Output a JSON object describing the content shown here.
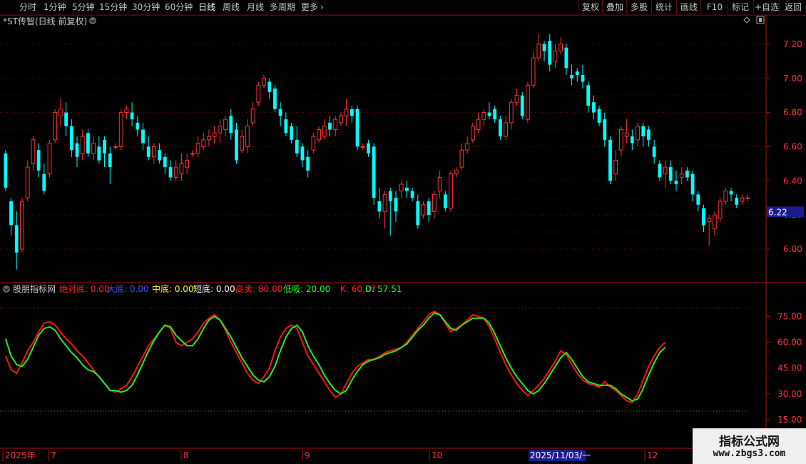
{
  "toolbar": {
    "periods": [
      "分时",
      "1分钟",
      "5分钟",
      "15分钟",
      "30分钟",
      "60分钟",
      "日线",
      "周线",
      "月线",
      "多周期",
      "更多"
    ],
    "active_period": "日线",
    "right": [
      "复权",
      "叠加",
      "多股",
      "统计",
      "画线",
      "F10",
      "标记",
      "+自选",
      "返回"
    ]
  },
  "price_panel": {
    "title": "*ST传智(日线 前复权)",
    "y_labels": [
      "7.20",
      "7.00",
      "6.80",
      "6.60",
      "6.40",
      "6.20",
      "6.00"
    ],
    "last_price": "6.22"
  },
  "indicator_panel": {
    "title": "股朋指标网",
    "items": [
      {
        "label": "绝对底:",
        "value": "0.00",
        "color": "#ff2222"
      },
      {
        "label": "大底:",
        "value": "0.00",
        "color": "#3355ff"
      },
      {
        "label": "中底:",
        "value": "0.00",
        "color": "#ffff00"
      },
      {
        "label": "短底:",
        "value": "0.00",
        "color": "#ffffff"
      },
      {
        "label": "高卖:",
        "value": "80.00",
        "color": "#ff2222"
      },
      {
        "label": "低吸:",
        "value": "20.00",
        "color": "#22ff22"
      },
      {
        "label": "K:",
        "value": "60.07",
        "color": "#ff2222"
      },
      {
        "label": "D:",
        "value": "57.51",
        "color": "#22ff22"
      }
    ],
    "y_labels": [
      "75.00",
      "60.00",
      "45.00",
      "30.00",
      "15.00"
    ]
  },
  "date_axis": {
    "labels": [
      "2025年",
      "7",
      "8",
      "9",
      "10",
      "11",
      "12"
    ],
    "cursor_date": "2025/11/03/一"
  },
  "watermark": {
    "title": "指标公式网",
    "url": "www.zbgs3.com"
  },
  "colors": {
    "up": "#ff3333",
    "down": "#00ffff",
    "k": "#ff1111",
    "d": "#22ee22",
    "grid": "#8b0000"
  },
  "chart_data": {
    "type": "candlestick",
    "title": "*ST传智(日线 前复权)",
    "ylim": [
      5.82,
      7.3
    ],
    "candles": [
      [
        6.56,
        6.36,
        6.58,
        6.34
      ],
      [
        6.28,
        6.14,
        6.3,
        6.08
      ],
      [
        6.14,
        5.98,
        6.22,
        5.88
      ],
      [
        6.0,
        6.28,
        6.3,
        5.98
      ],
      [
        6.3,
        6.48,
        6.52,
        6.28
      ],
      [
        6.5,
        6.64,
        6.66,
        6.46
      ],
      [
        6.58,
        6.46,
        6.62,
        6.42
      ],
      [
        6.44,
        6.34,
        6.5,
        6.32
      ],
      [
        6.44,
        6.62,
        6.64,
        6.42
      ],
      [
        6.64,
        6.8,
        6.82,
        6.62
      ],
      [
        6.78,
        6.82,
        6.88,
        6.72
      ],
      [
        6.8,
        6.72,
        6.86,
        6.66
      ],
      [
        6.72,
        6.58,
        6.76,
        6.54
      ],
      [
        6.62,
        6.54,
        6.66,
        6.48
      ],
      [
        6.56,
        6.66,
        6.7,
        6.52
      ],
      [
        6.68,
        6.56,
        6.7,
        6.54
      ],
      [
        6.56,
        6.62,
        6.66,
        6.52
      ],
      [
        6.6,
        6.52,
        6.66,
        6.5
      ],
      [
        6.64,
        6.56,
        6.66,
        6.48
      ],
      [
        6.56,
        6.48,
        6.6,
        6.38
      ],
      [
        6.6,
        6.6,
        6.62,
        6.58
      ],
      [
        6.6,
        6.8,
        6.82,
        6.58
      ],
      [
        6.8,
        6.82,
        6.84,
        6.76
      ],
      [
        6.8,
        6.76,
        6.86,
        6.72
      ],
      [
        6.74,
        6.7,
        6.78,
        6.66
      ],
      [
        6.7,
        6.62,
        6.74,
        6.58
      ],
      [
        6.6,
        6.54,
        6.66,
        6.52
      ],
      [
        6.54,
        6.6,
        6.62,
        6.5
      ],
      [
        6.58,
        6.52,
        6.62,
        6.5
      ],
      [
        6.54,
        6.48,
        6.56,
        6.44
      ],
      [
        6.48,
        6.42,
        6.52,
        6.4
      ],
      [
        6.42,
        6.48,
        6.52,
        6.4
      ],
      [
        6.44,
        6.5,
        6.56,
        6.4
      ],
      [
        6.48,
        6.52,
        6.56,
        6.44
      ],
      [
        6.56,
        6.56,
        6.58,
        6.54
      ],
      [
        6.56,
        6.62,
        6.66,
        6.54
      ],
      [
        6.6,
        6.64,
        6.68,
        6.58
      ],
      [
        6.64,
        6.66,
        6.7,
        6.6
      ],
      [
        6.66,
        6.68,
        6.72,
        6.62
      ],
      [
        6.68,
        6.72,
        6.76,
        6.62
      ],
      [
        6.7,
        6.76,
        6.78,
        6.66
      ],
      [
        6.78,
        6.68,
        6.82,
        6.64
      ],
      [
        6.7,
        6.52,
        6.74,
        6.5
      ],
      [
        6.58,
        6.66,
        6.7,
        6.56
      ],
      [
        6.6,
        6.72,
        6.76,
        6.56
      ],
      [
        6.74,
        6.82,
        6.86,
        6.72
      ],
      [
        6.86,
        6.96,
        6.98,
        6.84
      ],
      [
        6.96,
        7.0,
        7.02,
        6.94
      ],
      [
        6.98,
        6.92,
        7.0,
        6.88
      ],
      [
        6.94,
        6.82,
        6.96,
        6.8
      ],
      [
        6.82,
        6.78,
        6.86,
        6.72
      ],
      [
        6.76,
        6.68,
        6.8,
        6.66
      ],
      [
        6.72,
        6.64,
        6.74,
        6.62
      ],
      [
        6.64,
        6.56,
        6.72,
        6.54
      ],
      [
        6.6,
        6.52,
        6.62,
        6.48
      ],
      [
        6.54,
        6.46,
        6.58,
        6.42
      ],
      [
        6.58,
        6.66,
        6.68,
        6.56
      ],
      [
        6.64,
        6.7,
        6.72,
        6.62
      ],
      [
        6.66,
        6.72,
        6.76,
        6.64
      ],
      [
        6.74,
        6.7,
        6.78,
        6.66
      ],
      [
        6.7,
        6.76,
        6.78,
        6.66
      ],
      [
        6.74,
        6.78,
        6.8,
        6.72
      ],
      [
        6.78,
        6.82,
        6.88,
        6.72
      ],
      [
        6.82,
        6.78,
        6.84,
        6.74
      ],
      [
        6.82,
        6.6,
        6.84,
        6.58
      ],
      [
        6.6,
        6.6,
        6.62,
        6.58
      ],
      [
        6.62,
        6.56,
        6.64,
        6.54
      ],
      [
        6.6,
        6.3,
        6.62,
        6.26
      ],
      [
        6.28,
        6.22,
        6.36,
        6.18
      ],
      [
        6.22,
        6.32,
        6.34,
        6.12
      ],
      [
        6.34,
        6.28,
        6.36,
        6.08
      ],
      [
        6.3,
        6.22,
        6.34,
        6.16
      ],
      [
        6.34,
        6.38,
        6.4,
        6.3
      ],
      [
        6.36,
        6.34,
        6.4,
        6.3
      ],
      [
        6.34,
        6.3,
        6.36,
        6.28
      ],
      [
        6.28,
        6.14,
        6.32,
        6.12
      ],
      [
        6.2,
        6.26,
        6.28,
        6.18
      ],
      [
        6.28,
        6.2,
        6.3,
        6.16
      ],
      [
        6.22,
        6.32,
        6.34,
        6.18
      ],
      [
        6.34,
        6.42,
        6.46,
        6.3
      ],
      [
        6.32,
        6.24,
        6.34,
        6.22
      ],
      [
        6.24,
        6.44,
        6.46,
        6.22
      ],
      [
        6.44,
        6.46,
        6.48,
        6.42
      ],
      [
        6.48,
        6.58,
        6.62,
        6.46
      ],
      [
        6.58,
        6.62,
        6.66,
        6.56
      ],
      [
        6.64,
        6.72,
        6.74,
        6.62
      ],
      [
        6.7,
        6.76,
        6.8,
        6.68
      ],
      [
        6.76,
        6.8,
        6.82,
        6.72
      ],
      [
        6.8,
        6.78,
        6.86,
        6.76
      ],
      [
        6.82,
        6.76,
        6.84,
        6.74
      ],
      [
        6.76,
        6.66,
        6.78,
        6.64
      ],
      [
        6.66,
        6.74,
        6.78,
        6.64
      ],
      [
        6.74,
        6.86,
        6.88,
        6.7
      ],
      [
        6.86,
        6.9,
        6.94,
        6.84
      ],
      [
        6.9,
        6.78,
        6.92,
        6.76
      ],
      [
        6.76,
        6.96,
        6.98,
        6.74
      ],
      [
        6.96,
        7.12,
        7.16,
        6.94
      ],
      [
        7.12,
        7.2,
        7.26,
        7.1
      ],
      [
        7.2,
        7.16,
        7.22,
        7.1
      ],
      [
        7.22,
        7.08,
        7.26,
        7.04
      ],
      [
        7.1,
        7.16,
        7.2,
        7.06
      ],
      [
        7.16,
        7.2,
        7.24,
        7.14
      ],
      [
        7.18,
        7.06,
        7.2,
        7.02
      ],
      [
        7.02,
        7.0,
        7.08,
        6.96
      ],
      [
        7.04,
        7.02,
        7.06,
        6.98
      ],
      [
        7.02,
        6.98,
        7.08,
        6.94
      ],
      [
        6.96,
        6.84,
        6.98,
        6.8
      ],
      [
        6.86,
        6.8,
        6.9,
        6.76
      ],
      [
        6.82,
        6.74,
        6.84,
        6.72
      ],
      [
        6.76,
        6.64,
        6.8,
        6.6
      ],
      [
        6.64,
        6.4,
        6.66,
        6.38
      ],
      [
        6.44,
        6.52,
        6.58,
        6.4
      ],
      [
        6.58,
        6.7,
        6.72,
        6.54
      ],
      [
        6.66,
        6.68,
        6.76,
        6.62
      ],
      [
        6.66,
        6.62,
        6.7,
        6.58
      ],
      [
        6.64,
        6.72,
        6.74,
        6.6
      ],
      [
        6.72,
        6.66,
        6.74,
        6.6
      ],
      [
        6.7,
        6.64,
        6.72,
        6.6
      ],
      [
        6.6,
        6.54,
        6.64,
        6.5
      ],
      [
        6.5,
        6.42,
        6.52,
        6.4
      ],
      [
        6.44,
        6.48,
        6.52,
        6.36
      ],
      [
        6.48,
        6.4,
        6.52,
        6.38
      ],
      [
        6.4,
        6.38,
        6.46,
        6.34
      ],
      [
        6.42,
        6.44,
        6.48,
        6.38
      ],
      [
        6.46,
        6.42,
        6.48,
        6.4
      ],
      [
        6.44,
        6.32,
        6.46,
        6.28
      ],
      [
        6.32,
        6.26,
        6.34,
        6.22
      ],
      [
        6.24,
        6.14,
        6.26,
        6.1
      ],
      [
        6.16,
        6.18,
        6.2,
        6.02
      ],
      [
        6.12,
        6.2,
        6.22,
        6.08
      ],
      [
        6.18,
        6.28,
        6.3,
        6.16
      ],
      [
        6.28,
        6.34,
        6.36,
        6.26
      ],
      [
        6.34,
        6.32,
        6.36,
        6.28
      ],
      [
        6.3,
        6.26,
        6.32,
        6.24
      ],
      [
        6.28,
        6.3,
        6.32,
        6.26
      ],
      [
        6.3,
        6.3,
        6.32,
        6.28
      ]
    ],
    "k_series": [
      52,
      44,
      42,
      48,
      55,
      60,
      66,
      71,
      72,
      70,
      66,
      62,
      59,
      55,
      52,
      48,
      44,
      40,
      36,
      32,
      31,
      33,
      35,
      40,
      46,
      52,
      58,
      62,
      66,
      70,
      68,
      60,
      58,
      60,
      62,
      66,
      71,
      74,
      76,
      73,
      67,
      60,
      54,
      48,
      42,
      38,
      36,
      40,
      45,
      55,
      63,
      68,
      70,
      68,
      60,
      52,
      47,
      42,
      37,
      32,
      28,
      30,
      36,
      42,
      46,
      48,
      50,
      50,
      52,
      54,
      55,
      56,
      57,
      60,
      64,
      68,
      72,
      76,
      78,
      76,
      71,
      66,
      68,
      70,
      73,
      76,
      75,
      74,
      69,
      62,
      54,
      47,
      41,
      36,
      32,
      29,
      32,
      35,
      39,
      44,
      49,
      55,
      53,
      47,
      42,
      38,
      36,
      35,
      34,
      37,
      34,
      32,
      29,
      26,
      25,
      30,
      38,
      46,
      52,
      57,
      60
    ],
    "d_series": [
      62,
      52,
      47,
      46,
      50,
      57,
      64,
      68,
      69,
      67,
      62,
      58,
      54,
      51,
      47,
      44,
      43,
      40,
      36,
      32,
      32,
      31,
      32,
      35,
      41,
      48,
      55,
      61,
      66,
      70,
      69,
      64,
      61,
      58,
      58,
      62,
      68,
      73,
      75,
      73,
      68,
      63,
      57,
      51,
      46,
      41,
      38,
      37,
      40,
      46,
      55,
      63,
      68,
      70,
      66,
      58,
      52,
      47,
      41,
      36,
      32,
      30,
      32,
      38,
      43,
      47,
      49,
      50,
      51,
      53,
      54,
      55,
      57,
      59,
      63,
      67,
      70,
      74,
      77,
      76,
      72,
      68,
      67,
      70,
      72,
      74,
      74,
      74,
      71,
      65,
      58,
      51,
      45,
      40,
      36,
      32,
      30,
      32,
      36,
      41,
      46,
      51,
      54,
      50,
      45,
      40,
      37,
      36,
      35,
      35,
      35,
      33,
      30,
      28,
      26,
      27,
      33,
      41,
      48,
      54,
      57
    ],
    "k_ylim": [
      10,
      88
    ],
    "reference_lines": {
      "high": 80,
      "low": 20
    },
    "date_label": "2025/11/03/一"
  }
}
